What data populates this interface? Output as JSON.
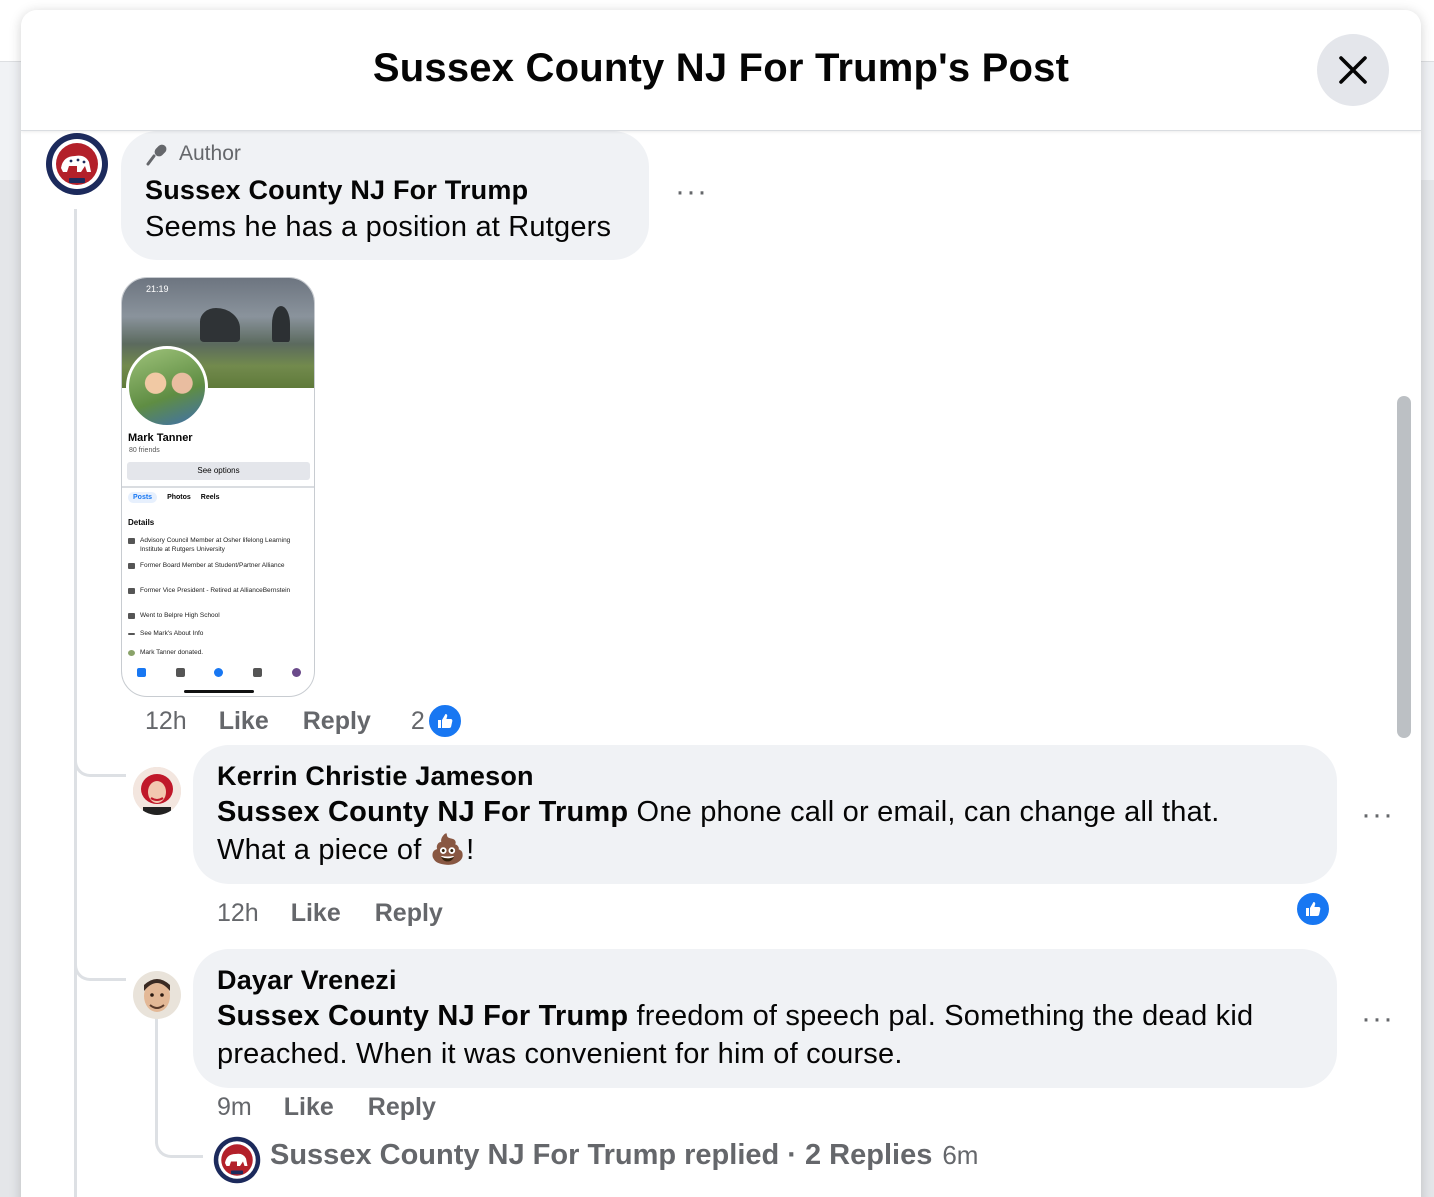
{
  "dialog": {
    "title": "Sussex County NJ For Trump's Post",
    "close_label": "×"
  },
  "comments": [
    {
      "author_badge": "Author",
      "name": "Sussex County NJ For Trump",
      "text": "Seems he has a position at Rutgers",
      "time": "12h",
      "like_label": "Like",
      "reply_label": "Reply",
      "reaction_count": "2",
      "attachment": {
        "status_time": "21:19",
        "profile_name": "Mark Tanner",
        "friends": "80 friends",
        "see_options": "See options",
        "tabs": [
          "Posts",
          "Photos",
          "Reels"
        ],
        "details_heading": "Details",
        "details": [
          "Advisory Council Member at Osher lifelong Learning Institute at Rutgers University",
          "Former Board Member at Student/Partner Alliance",
          "Former Vice President - Retired at AllianceBernstein",
          "Went to Belpre High School",
          "See Mark's About Info"
        ],
        "post_preview": "Mark Tanner donated."
      }
    },
    {
      "name": "Kerrin Christie Jameson",
      "mention": "Sussex County NJ For Trump",
      "text_line1": " One phone call or email, can change all that.",
      "text_line2": "What a piece of ",
      "emoji": "💩",
      "text_end": "!",
      "time": "12h",
      "like_label": "Like",
      "reply_label": "Reply"
    },
    {
      "name": "Dayar Vrenezi",
      "mention": "Sussex County NJ For Trump",
      "text_line1": " freedom of speech pal. Something the dead kid",
      "text_line2": "preached. When it was convenient for him of course.",
      "time": "9m",
      "like_label": "Like",
      "reply_label": "Reply",
      "replies_summary": {
        "text": "Sussex County NJ For Trump replied · 2 Replies",
        "time": "6m"
      }
    }
  ],
  "more_options_label": "···",
  "colors": {
    "accent": "#1877f2",
    "bubble": "#f0f2f5",
    "secondary_text": "#65676b",
    "gop_navy": "#1c2a5c",
    "gop_red": "#b3202a"
  }
}
